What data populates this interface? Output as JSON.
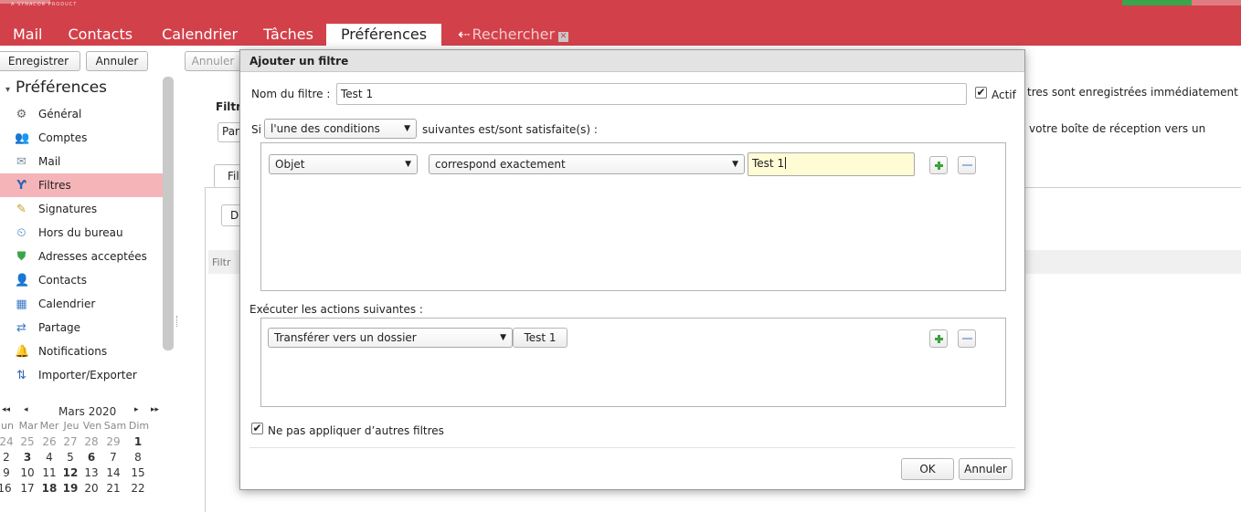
{
  "app": {
    "brand_tag": "A SYNACOR PRODUCT",
    "tabs": [
      {
        "label": "Mail"
      },
      {
        "label": "Contacts"
      },
      {
        "label": "Calendrier"
      },
      {
        "label": "Tâches"
      },
      {
        "label": "Préférences"
      },
      {
        "label": "Rechercher"
      }
    ],
    "active_tab": "Préférences",
    "accent_color": "#d2414a"
  },
  "toolbar": {
    "save_label": "Enregistrer",
    "cancel_label": "Annuler",
    "cancel2_label": "Annuler"
  },
  "sidebar": {
    "title": "Préférences",
    "items": [
      {
        "label": "Général",
        "icon": "gear-icon"
      },
      {
        "label": "Comptes",
        "icon": "accounts-icon"
      },
      {
        "label": "Mail",
        "icon": "mail-icon"
      },
      {
        "label": "Filtres",
        "icon": "filter-icon",
        "selected": true
      },
      {
        "label": "Signatures",
        "icon": "signature-icon"
      },
      {
        "label": "Hors du bureau",
        "icon": "out-of-office-icon"
      },
      {
        "label": "Adresses acceptées",
        "icon": "shield-icon"
      },
      {
        "label": "Contacts",
        "icon": "contacts-icon"
      },
      {
        "label": "Calendrier",
        "icon": "calendar-icon"
      },
      {
        "label": "Partage",
        "icon": "share-icon"
      },
      {
        "label": "Notifications",
        "icon": "bell-icon"
      },
      {
        "label": "Importer/Exporter",
        "icon": "import-export-icon"
      }
    ]
  },
  "calendar": {
    "month": "Mars 2020",
    "prev_year": "◂◂",
    "prev": "◂",
    "next": "▸",
    "next_year": "▸▸",
    "weekdays": [
      "un",
      "Mar",
      "Mer",
      "Jeu",
      "Ven",
      "Sam",
      "Dim"
    ],
    "weeks": [
      [
        "24",
        "25",
        "26",
        "27",
        "28",
        "29",
        "1"
      ],
      [
        "2",
        "3",
        "4",
        "5",
        "6",
        "7",
        "8"
      ],
      [
        "9",
        "10",
        "11",
        "12",
        "13",
        "14",
        "15"
      ],
      [
        "16",
        "17",
        "18",
        "19",
        "20",
        "21",
        "22"
      ]
    ]
  },
  "background": {
    "title_fragment": "Filtr",
    "select_fragment": "Par",
    "tab_fragment": "Fil",
    "button_fragment": "D",
    "list_fragment": "Filtr",
    "right_text_1": "tres sont enregistrées immédiatement",
    "right_text_2": "votre boîte de réception vers un"
  },
  "dialog": {
    "title": "Ajouter un filtre",
    "name_label": "Nom du filtre :",
    "name_value": "Test 1",
    "active_label": "Actif",
    "active_checked": true,
    "if_label": "Si",
    "condition_mode": "l'une des conditions",
    "condition_suffix": "suivantes est/sont satisfaite(s) :",
    "condition": {
      "field": "Objet",
      "operator": "correspond exactement",
      "value": "Test 1"
    },
    "actions_label": "Exécuter les actions suivantes :",
    "action": {
      "type": "Transférer vers un dossier",
      "folder": "Test 1"
    },
    "stop_label": "Ne pas appliquer d’autres filtres",
    "stop_checked": true,
    "ok_label": "OK",
    "cancel_label": "Annuler"
  }
}
